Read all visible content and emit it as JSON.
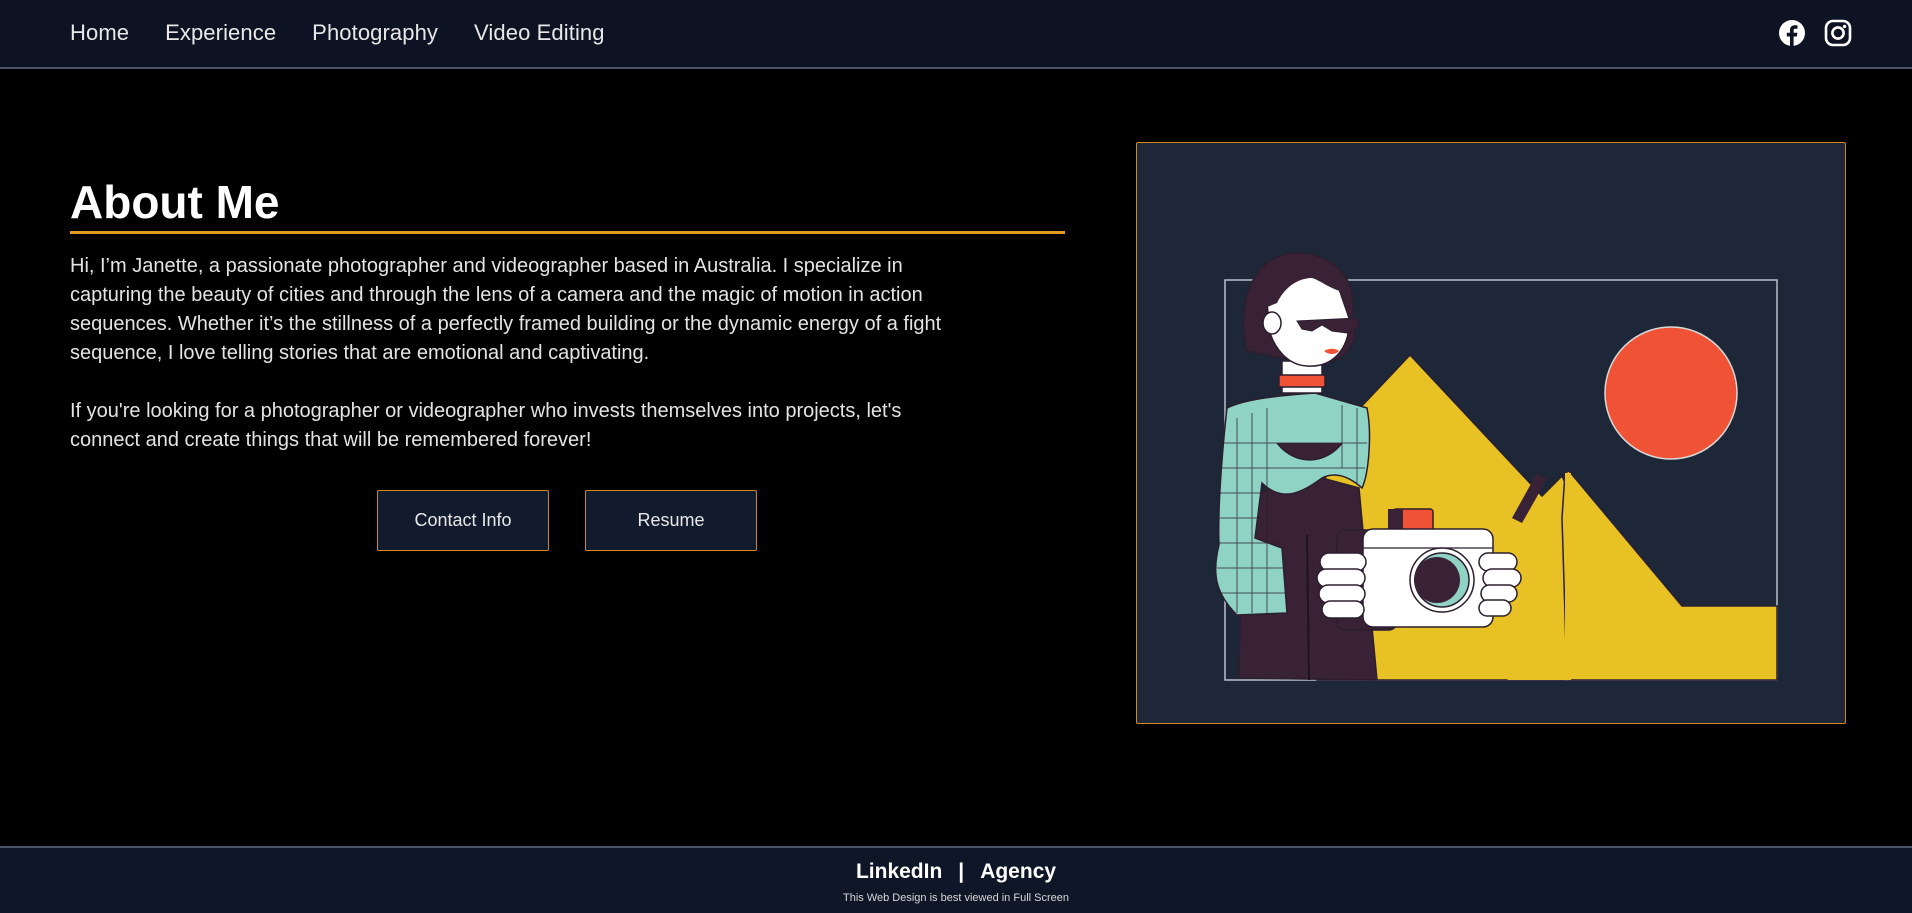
{
  "nav": {
    "links": [
      "Home",
      "Experience",
      "Photography",
      "Video Editing"
    ],
    "socials": [
      {
        "icon": "facebook-icon"
      },
      {
        "icon": "instagram-icon"
      }
    ]
  },
  "about": {
    "title": "About Me",
    "paragraph1": "Hi, I’m Janette, a passionate photographer and videographer based in Australia. I specialize in capturing the beauty of cities and through the lens of a camera and the magic of motion in action sequences. Whether it’s the stillness of a perfectly framed building or the dynamic energy of a fight sequence, I love telling stories that are emotional and captivating.",
    "paragraph2": "If you're looking for a photographer or videographer who invests themselves into projects, let's connect and create things that will be remembered forever!",
    "buttons": {
      "contact": "Contact Info",
      "resume": "Resume"
    }
  },
  "illustration": {
    "subject": "woman-photographer-illustration",
    "colors": {
      "background": "#1d2738",
      "mountain": "#e8c224",
      "sun": "#ef5234",
      "shirt": "#8fd3c4",
      "dress": "#3a2236",
      "accent": "#d08b1f"
    }
  },
  "footer": {
    "link1": "LinkedIn",
    "separator": "|",
    "link2": "Agency",
    "note": "This Web Design is best viewed in Full Screen"
  }
}
